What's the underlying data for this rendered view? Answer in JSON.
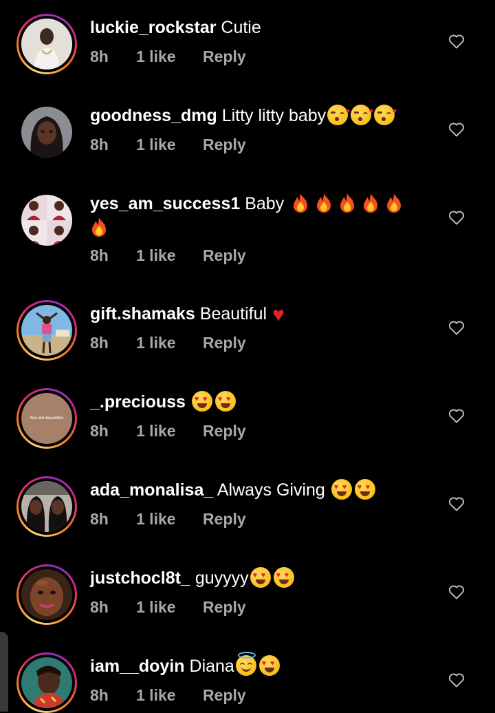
{
  "comments": [
    {
      "username": "luckie_rockstar",
      "text": "Cutie",
      "emojis": [],
      "time": "8h",
      "likes": "1 like",
      "reply": "Reply",
      "story_ring": true,
      "avatar": "person-with-necklace"
    },
    {
      "username": "goodness_dmg",
      "text": "Litty litty baby",
      "emojis": [
        "face-blowing-kiss",
        "face-blowing-kiss",
        "face-blowing-kiss"
      ],
      "time": "8h",
      "likes": "1 like",
      "reply": "Reply",
      "story_ring": false,
      "avatar": "woman-selfie"
    },
    {
      "username": "yes_am_success1",
      "text": "Baby",
      "emojis": [
        "fire",
        "fire",
        "fire",
        "fire",
        "fire",
        "fire"
      ],
      "time": "8h",
      "likes": "1 like",
      "reply": "Reply",
      "story_ring": false,
      "avatar": "group-collage"
    },
    {
      "username": "gift.shamaks",
      "text": "Beautiful",
      "emojis": [
        "red-heart"
      ],
      "time": "8h",
      "likes": "1 like",
      "reply": "Reply",
      "story_ring": true,
      "avatar": "person-sky"
    },
    {
      "username": "_.preciouss",
      "text": "",
      "emojis": [
        "heart-eyes",
        "heart-eyes"
      ],
      "time": "8h",
      "likes": "1 like",
      "reply": "Reply",
      "story_ring": true,
      "avatar": "text-card",
      "avatar_text": "You are beautiful."
    },
    {
      "username": "ada_monalisa_",
      "text": "Always Giving",
      "emojis": [
        "heart-eyes",
        "heart-eyes"
      ],
      "time": "8h",
      "likes": "1 like",
      "reply": "Reply",
      "story_ring": true,
      "avatar": "two-women"
    },
    {
      "username": "justchocl8t_",
      "text": "guyyyy",
      "emojis": [
        "heart-eyes",
        "heart-eyes"
      ],
      "time": "8h",
      "likes": "1 like",
      "reply": "Reply",
      "story_ring": true,
      "avatar": "close-up-face"
    },
    {
      "username": "iam__doyin",
      "text": "Diana",
      "emojis": [
        "smiling-face-with-halo",
        "heart-eyes"
      ],
      "time": "8h",
      "likes": "1 like",
      "reply": "Reply",
      "story_ring": true,
      "avatar": "woman-portrait"
    }
  ],
  "colors": {
    "background": "#000000",
    "text": "#ffffff",
    "meta_text": "#a8a8a8",
    "story_ring_start": "#feda75",
    "story_ring_end": "#d62976"
  },
  "icons": {
    "like": "heart-outline-icon"
  }
}
